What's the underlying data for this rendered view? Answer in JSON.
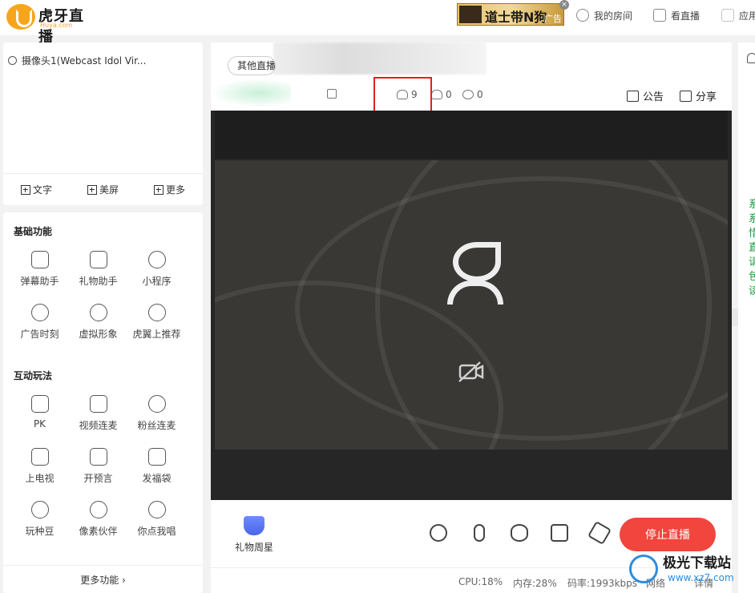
{
  "app": {
    "brand": "虎牙直播",
    "brand_sub": "Huya.com"
  },
  "ad": {
    "text": "道士带N狗",
    "tag": "广告",
    "close": "×"
  },
  "nav": {
    "my_room": "我的房间",
    "watch_live": "看直播",
    "apps": "应用"
  },
  "source": {
    "camera_name": "摄像头1(Webcast Idol Vir...",
    "actions": [
      "文字",
      "美屏",
      "更多"
    ]
  },
  "features": {
    "basic_title": "基础功能",
    "basic_items": [
      "弹幕助手",
      "礼物助手",
      "小程序",
      "广告时刻",
      "虚拟形象",
      "虎翼上推荐"
    ],
    "interactive_title": "互动玩法",
    "interactive_items": [
      "PK",
      "视频连麦",
      "粉丝连麦",
      "上电视",
      "开预言",
      "发福袋",
      "玩种豆",
      "像素伙伴",
      "你点我唱"
    ],
    "more": "更多功能 ›"
  },
  "main": {
    "other_live_tag": "其他直播",
    "stats": {
      "viewers": "9",
      "likes": "0",
      "shares": "0"
    },
    "announce": "公告",
    "share": "分享",
    "gift_star": "礼物周星",
    "stop_live": "停止直播"
  },
  "status": {
    "cpu": "CPU:18%",
    "memory": "内存:28%",
    "bitrate": "码率:1993kbps",
    "network": "网络",
    "detail": "详情"
  },
  "right_panel": {
    "text": "系\n系\n惜\n直\n请\n包\n读"
  },
  "watermark": {
    "name": "极光下载站",
    "url": "www.xz7.com"
  }
}
